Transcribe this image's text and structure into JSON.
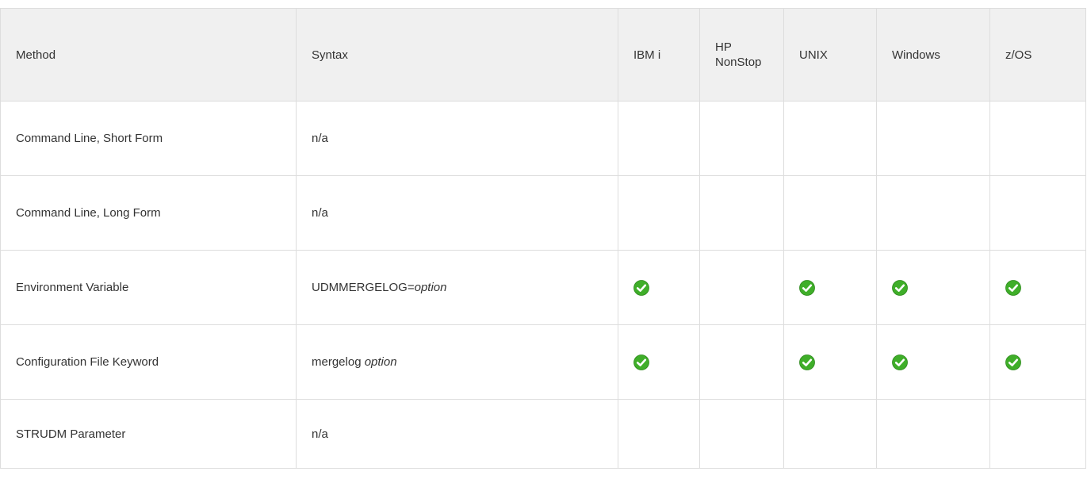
{
  "table": {
    "headers": [
      "Method",
      "Syntax",
      "IBM i",
      "HP\nNonStop",
      "UNIX",
      "Windows",
      "z/OS"
    ],
    "rows": [
      {
        "method": "Command Line, Short Form",
        "syntax": "n/a",
        "syntax_italic": "",
        "support": [
          false,
          false,
          false,
          false,
          false
        ]
      },
      {
        "method": "Command Line, Long Form",
        "syntax": "n/a",
        "syntax_italic": "",
        "support": [
          false,
          false,
          false,
          false,
          false
        ]
      },
      {
        "method": "Environment Variable",
        "syntax": "UDMMERGELOG=",
        "syntax_italic": "option",
        "support": [
          true,
          false,
          true,
          true,
          true
        ]
      },
      {
        "method": "Configuration File Keyword",
        "syntax": "mergelog ",
        "syntax_italic": "option",
        "support": [
          true,
          false,
          true,
          true,
          true
        ]
      },
      {
        "method": "STRUDM Parameter",
        "syntax": "n/a",
        "syntax_italic": "",
        "support": [
          false,
          false,
          false,
          false,
          false
        ]
      }
    ]
  },
  "icons": {
    "check": "check-circle-icon"
  },
  "colors": {
    "header_bg": "#f0f0f0",
    "border": "#dddddd",
    "check_green": "#3fae29"
  }
}
